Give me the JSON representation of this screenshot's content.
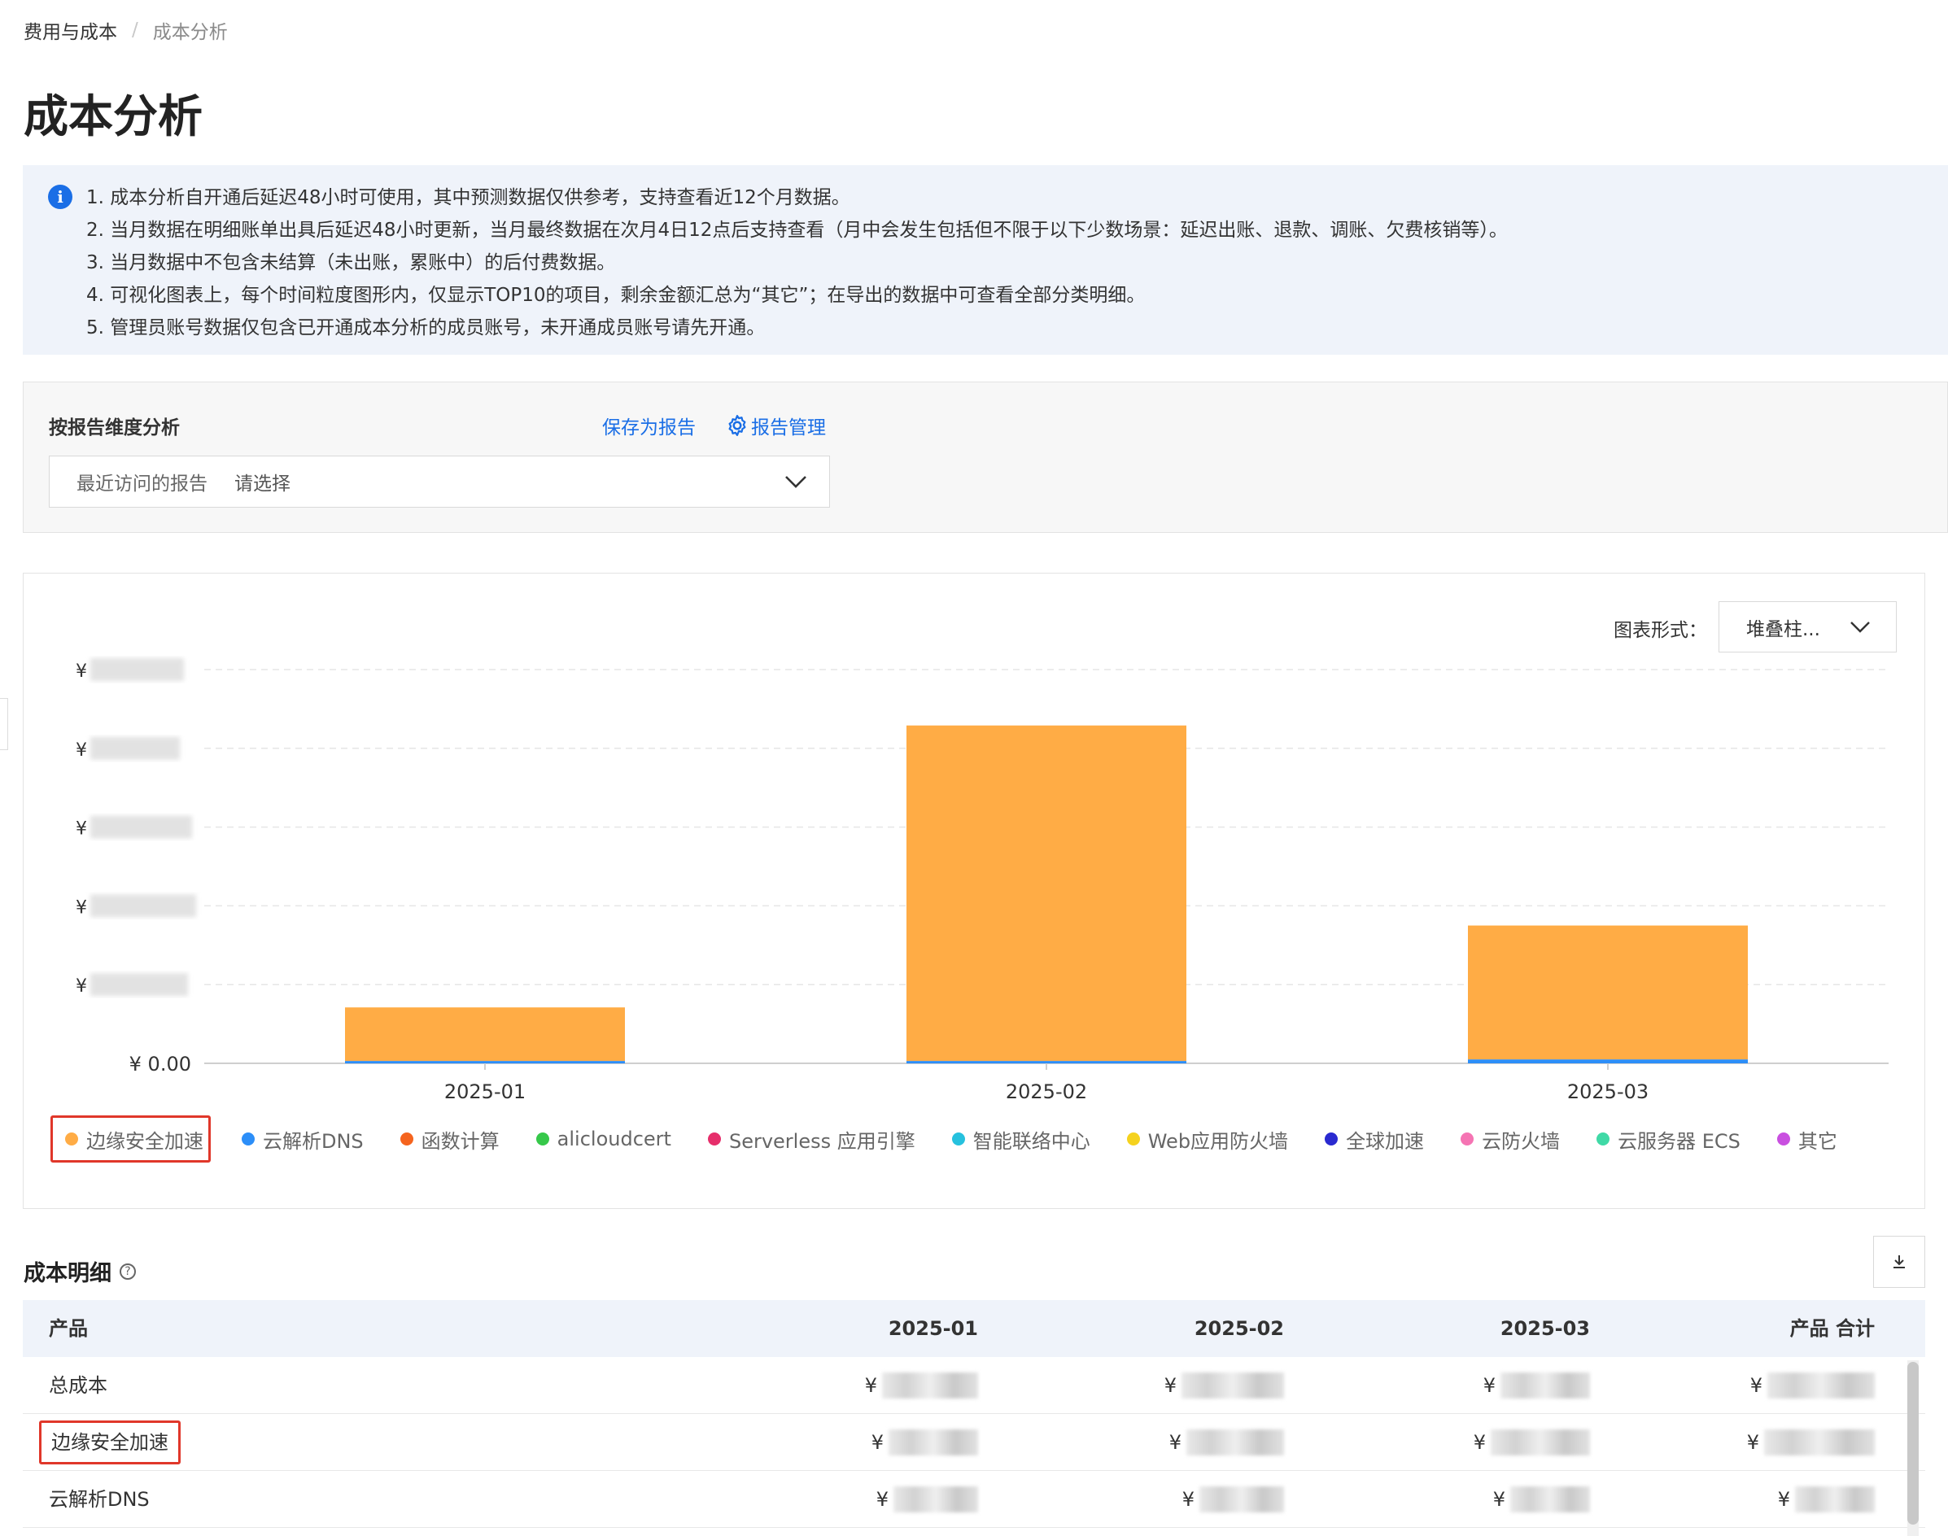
{
  "breadcrumb": {
    "parent": "费用与成本",
    "current": "成本分析"
  },
  "page_title": "成本分析",
  "notice": {
    "lines": [
      "1. 成本分析自开通后延迟48小时可使用，其中预测数据仅供参考，支持查看近12个月数据。",
      "2. 当月数据在明细账单出具后延迟48小时更新，当月最终数据在次月4日12点后支持查看（月中会发生包括但不限于以下少数场景：延迟出账、退款、调账、欠费核销等）。",
      "3. 当月数据中不包含未结算（未出账，累账中）的后付费数据。",
      "4. 可视化图表上，每个时间粒度图形内，仅显示TOP10的项目，剩余金额汇总为“其它”；在导出的数据中可查看全部分类明细。",
      "5. 管理员账号数据仅包含已开通成本分析的成员账号，未开通成员账号请先开通。"
    ]
  },
  "report": {
    "label": "按报告维度分析",
    "save_link": "保存为报告",
    "manage_link": "报告管理",
    "select_prefix": "最近访问的报告",
    "select_placeholder": "请选择"
  },
  "chart_controls": {
    "type_label": "图表形式：",
    "type_value": "堆叠柱..."
  },
  "chart_data": {
    "type": "bar",
    "stacked": true,
    "categories": [
      "2025-01",
      "2025-02",
      "2025-03"
    ],
    "y_tick_labels": [
      "¥ 0.00",
      "¥",
      "¥",
      "¥",
      "¥",
      "¥"
    ],
    "ylim": [
      0,
      5
    ],
    "series": [
      {
        "name": "边缘安全加速",
        "color": "#ffac45",
        "values": [
          0.68,
          4.26,
          1.7
        ]
      },
      {
        "name": "云解析DNS",
        "color": "#2c8ef8",
        "values": [
          0.03,
          0.03,
          0.05
        ]
      },
      {
        "name": "函数计算",
        "color": "#f5641e",
        "values": [
          0,
          0,
          0
        ]
      },
      {
        "name": "alicloudcert",
        "color": "#36c84a",
        "values": [
          0,
          0,
          0
        ]
      },
      {
        "name": "Serverless 应用引擎",
        "color": "#e62e6b",
        "values": [
          0,
          0,
          0
        ]
      },
      {
        "name": "智能联络中心",
        "color": "#26c1de",
        "values": [
          0,
          0,
          0
        ]
      },
      {
        "name": "Web应用防火墙",
        "color": "#f5d21e",
        "values": [
          0,
          0,
          0
        ]
      },
      {
        "name": "全球加速",
        "color": "#2a2ad0",
        "values": [
          0,
          0,
          0
        ]
      },
      {
        "name": "云防火墙",
        "color": "#f574b3",
        "values": [
          0,
          0,
          0
        ]
      },
      {
        "name": "云服务器 ECS",
        "color": "#40d9a6",
        "values": [
          0,
          0,
          0
        ]
      },
      {
        "name": "其它",
        "color": "#c94fe0",
        "values": [
          0,
          0,
          0
        ]
      }
    ],
    "grid": true,
    "legend_position": "bottom",
    "selected_series": "边缘安全加速"
  },
  "detail": {
    "title": "成本明细",
    "help_icon": "question-circle-icon",
    "download_icon": "download-icon",
    "columns": [
      "产品",
      "2025-01",
      "2025-02",
      "2025-03",
      "产品 合计"
    ],
    "rows": [
      {
        "name": "总成本",
        "values": [
          "¥",
          "¥",
          "¥",
          "¥"
        ]
      },
      {
        "name": "边缘安全加速",
        "values": [
          "¥",
          "¥",
          "¥",
          "¥"
        ],
        "selected": true
      },
      {
        "name": "云解析DNS",
        "values": [
          "¥",
          "¥",
          "¥",
          "¥"
        ]
      }
    ]
  },
  "colors": {
    "accent": "#1a6ee6",
    "highlight_border": "#e0372a",
    "notice_bg": "#eff3fa"
  }
}
